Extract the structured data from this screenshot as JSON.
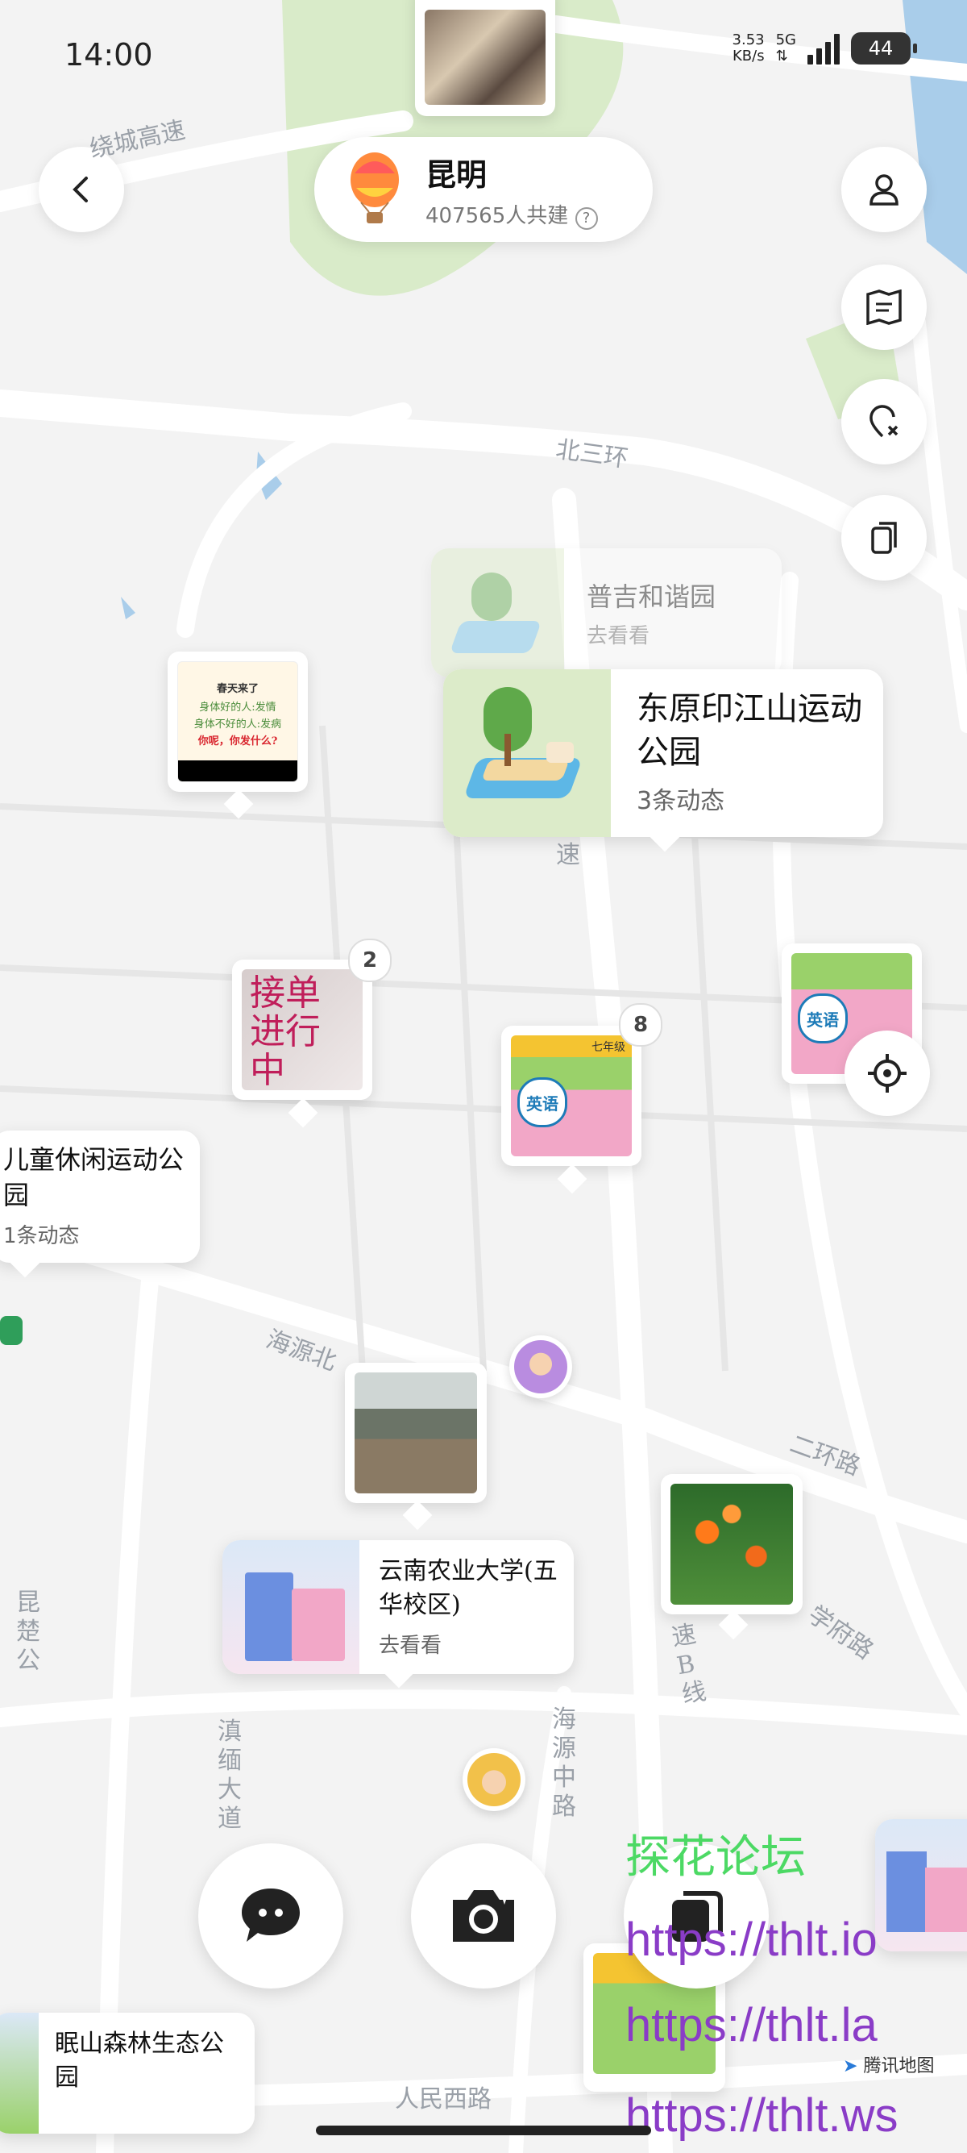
{
  "status_bar": {
    "time": "14:00",
    "net_speed": "3.53",
    "net_unit": "KB/s",
    "network": "5G",
    "battery": "44"
  },
  "city": {
    "name": "昆明",
    "contributors": "407565人共建"
  },
  "road_labels": {
    "ring_highway": "绕城高速",
    "north_third_ring": "北三环",
    "haiyuan_north": "海源北",
    "second_ring": "二环路",
    "xuefu": "学府路",
    "haiyuan_middle": "海源中路",
    "dian_mian": "滇缅大道",
    "renmin_west": "人民西路",
    "line_b": "速B线",
    "speed": "速",
    "kunshi": "昆楚公"
  },
  "places": {
    "pujie": {
      "title": "普吉和谐园",
      "action": "去看看"
    },
    "dongyuan": {
      "title": "东原印江山运动公园",
      "count": "3条动态"
    },
    "children_park": {
      "title": "儿童休闲运动公园",
      "count": "1条动态"
    },
    "yunnan_agri": {
      "title": "云南农业大学(五华校区)",
      "action": "去看看"
    },
    "mianshan": {
      "title": "眠山森林生态公园"
    }
  },
  "photo_pins": {
    "poster": {
      "line1": "春天来了",
      "line2": "身体好的人:发情",
      "line3": "身体不好的人:发病",
      "line4": "你呢，你发什么?"
    },
    "order": {
      "text": "接单进行中",
      "badge": "2"
    },
    "english": {
      "badge": "8",
      "subject": "英语",
      "grade": "七年级"
    }
  },
  "watermark": {
    "forum": "探花论坛",
    "url1": "https://thlt.io",
    "url2": "https://thlt.la",
    "url3": "https://thlt.ws"
  },
  "map_attribution": "腾讯地图",
  "colors": {
    "park_green": "#d9ebc9",
    "water_blue": "#a9cdea",
    "road": "#ffffff",
    "watermark_green": "#4cd964",
    "watermark_purple": "#8a3cc7",
    "watermark_red": "#e0303a"
  }
}
